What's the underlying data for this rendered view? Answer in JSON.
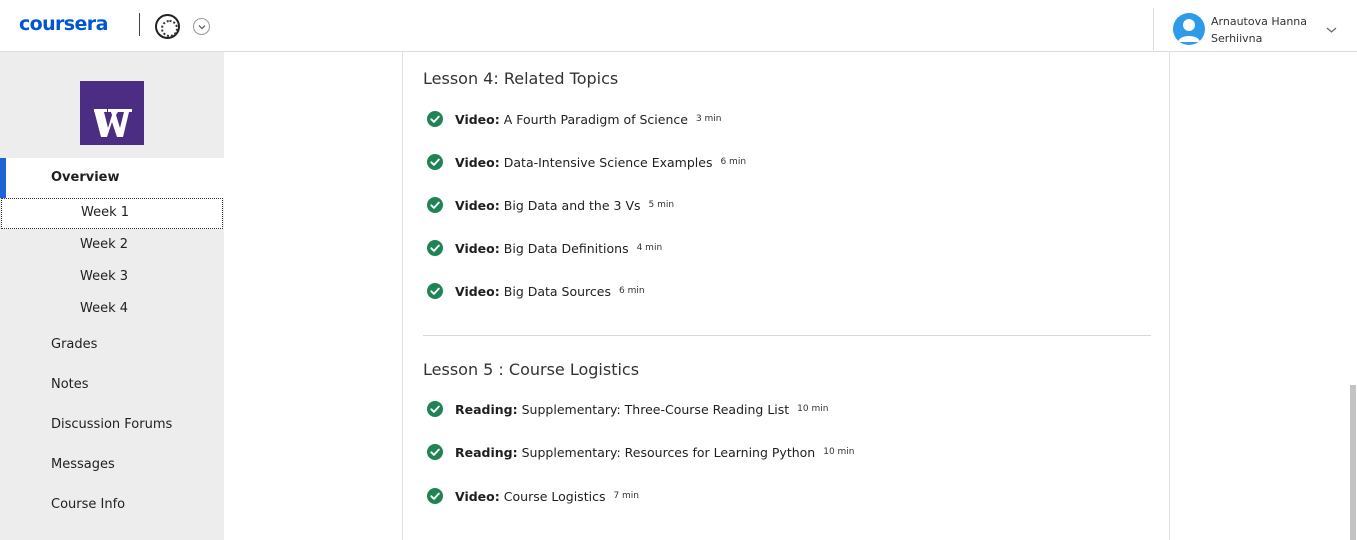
{
  "header": {
    "brand": "coursera",
    "user_name": "Arnautova Hanna Serhiivna"
  },
  "sidebar": {
    "overview": "Overview",
    "weeks": [
      "Week 1",
      "Week 2",
      "Week 3",
      "Week 4"
    ],
    "items": [
      "Grades",
      "Notes",
      "Discussion Forums",
      "Messages",
      "Course Info"
    ]
  },
  "lessons": [
    {
      "title": "Lesson 4: Related Topics",
      "items": [
        {
          "type": "Video:",
          "title": "A Fourth Paradigm of Science",
          "duration": "3 min"
        },
        {
          "type": "Video:",
          "title": "Data-Intensive Science Examples",
          "duration": "6 min"
        },
        {
          "type": "Video:",
          "title": "Big Data and the 3 Vs",
          "duration": "5 min"
        },
        {
          "type": "Video:",
          "title": "Big Data Definitions",
          "duration": "4 min"
        },
        {
          "type": "Video:",
          "title": "Big Data Sources",
          "duration": "6 min"
        }
      ]
    },
    {
      "title": "Lesson 5 : Course Logistics",
      "items": [
        {
          "type": "Reading:",
          "title": "Supplementary: Three-Course Reading List",
          "duration": "10 min"
        },
        {
          "type": "Reading:",
          "title": "Supplementary: Resources for Learning Python",
          "duration": "10 min"
        },
        {
          "type": "Video:",
          "title": "Course Logistics",
          "duration": "7 min"
        }
      ]
    }
  ],
  "colors": {
    "brand_blue": "#0056d2",
    "active_nav": "#1f64d5",
    "completed_check": "#1f8354",
    "course_logo_purple": "#4b2e83"
  },
  "icons": {
    "completed": "check-circle-icon",
    "avatar": "user-avatar-icon",
    "dropdown": "chevron-down-icon"
  }
}
